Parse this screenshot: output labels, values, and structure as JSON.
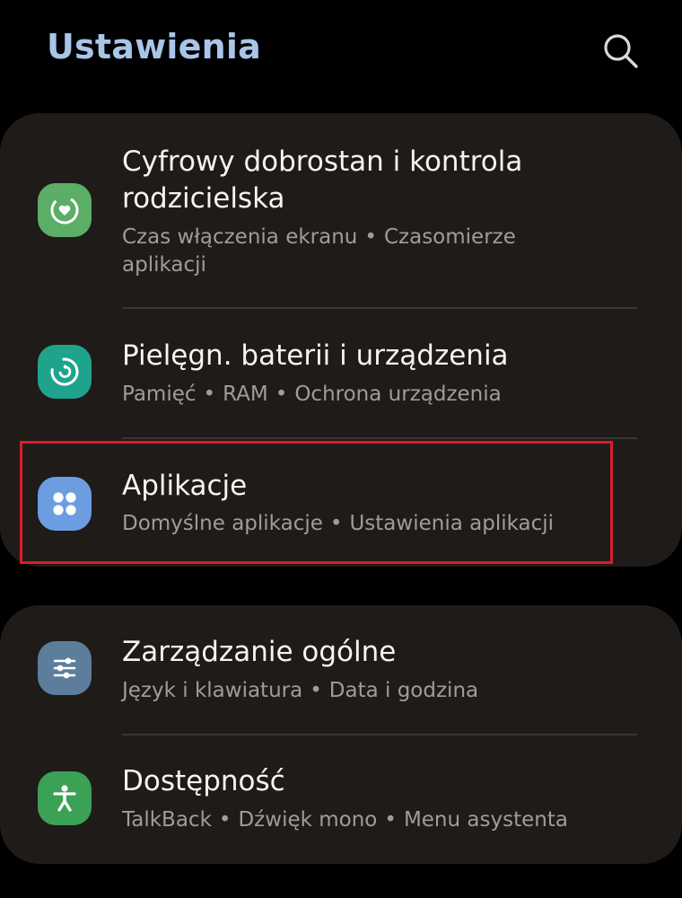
{
  "header": {
    "title": "Ustawienia",
    "search_icon": "search-icon"
  },
  "colors": {
    "background": "#000000",
    "card": "#1f1b18",
    "title": "#a9c5e8",
    "highlight": "#d81e2a"
  },
  "groups": [
    {
      "items": [
        {
          "icon": "digital-wellbeing-icon",
          "icon_color": "#5cad66",
          "title_line1": "Cyfrowy dobrostan i kontrola",
          "title_line2": "rodzicielska",
          "subtitle_parts": [
            "Czas włączenia ekranu",
            "Czasomierze"
          ],
          "subtitle_line2": "aplikacji"
        },
        {
          "icon": "device-care-icon",
          "icon_color": "#1fa38d",
          "title": "Pielęgn. baterii i urządzenia",
          "subtitle_parts": [
            "Pamięć",
            "RAM",
            "Ochrona urządzenia"
          ]
        },
        {
          "icon": "apps-icon",
          "icon_color": "#6b9de0",
          "title": "Aplikacje",
          "subtitle_parts": [
            "Domyślne aplikacje",
            "Ustawienia aplikacji"
          ]
        }
      ]
    },
    {
      "items": [
        {
          "icon": "general-management-icon",
          "icon_color": "#5c7d9c",
          "title": "Zarządzanie ogólne",
          "subtitle_parts": [
            "Język i klawiatura",
            "Data i godzina"
          ]
        },
        {
          "icon": "accessibility-icon",
          "icon_color": "#3aa155",
          "title": "Dostępność",
          "subtitle_parts": [
            "TalkBack",
            "Dźwięk mono",
            "Menu asystenta"
          ]
        }
      ]
    }
  ],
  "separator": "•"
}
